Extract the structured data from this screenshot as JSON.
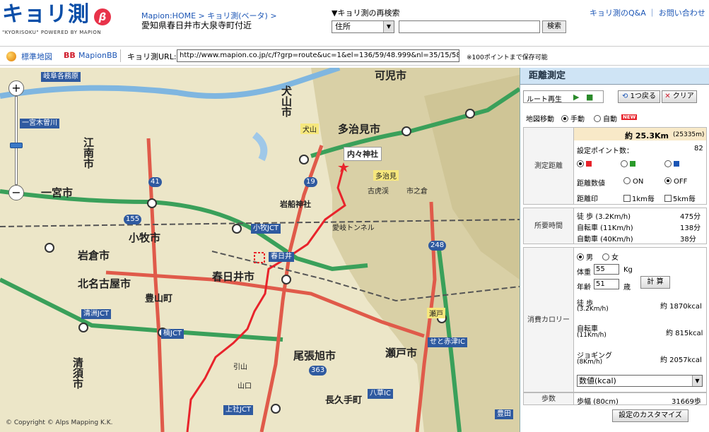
{
  "header": {
    "logo_text": "キョリ測",
    "logo_beta": "β",
    "logo_sub": "\"KYORISOKU\" POWERED BY MAPION",
    "breadcrumb": "Mapion:HOME > キョリ測(ベータ) >",
    "address": "愛知県春日井市大泉寺町付近",
    "research_title": "▼キョリ測の再検索",
    "research_select": "住所",
    "research_input": "",
    "research_button": "検索",
    "links": "キョリ測のQ&A ｜ お問い合わせ"
  },
  "toolbar": {
    "standard_map": "標準地図",
    "bb_icon": "BB",
    "mapion_bb": "MapionBB",
    "url_label": "キョリ測URL:",
    "url_value": "http://www.mapion.co.jp/c/f?grp=route&uc=1&el=136/59/48.999&nl=35/15/58.",
    "url_note": "※100ポイントまで保存可能"
  },
  "map": {
    "labels": {
      "kanimachi": "可児市",
      "inuyama": "犬山市",
      "tajimi": "多治見市",
      "konan": "江南市",
      "ichinomiya": "一宮市",
      "iwakura": "岩倉市",
      "komaki": "小牧市",
      "kitanagoya": "北名古屋市",
      "kasugai": "春日井市",
      "toyoyama": "豊山町",
      "owariasahi": "尾張旭市",
      "seto": "瀬戸市",
      "nagakute": "長久手町",
      "kiyosu": "清須市",
      "utsutsu_shrine": "内々神社",
      "iwafune_shrine": "岩船神社",
      "kasugai_ic": "春日井",
      "inuyama_tag": "犬山",
      "tajimi_tag": "多治見",
      "seto_tag": "瀬戸",
      "komaki_jct": "小牧JCT",
      "kiyosu_jct": "清洲JCT",
      "kachi_jct": "楠JCT",
      "kamishino_jct": "上社JCT",
      "yagusa_ic": "八草IC",
      "seto_akazu_ic": "せと赤津IC",
      "ichinomiya_kisogawa": "一宮木曽川",
      "gifu_hashima": "岐阜各務原",
      "toyota": "豊田",
      "route41": "41",
      "route19": "19",
      "route155": "155",
      "route248": "248",
      "route363": "363",
      "tunnel": "愛岐トンネル",
      "kokeihan": "古虎渓",
      "ichinokura": "市之倉",
      "yamaguchi": "山口",
      "hirakumo": "引山"
    },
    "copyright": "© Copyright © Alps Mapping K.K."
  },
  "panel": {
    "title": "距離測定",
    "route_play": "ルート再生",
    "back_one": "1つ戻る",
    "clear": "クリア",
    "map_move_label": "地図移動",
    "manual": "手動",
    "auto": "自動",
    "new_badge": "NEW",
    "distance_total": "約 25.3Km",
    "distance_m": "(25335m)",
    "measure_label": "測定距離",
    "points_label": "設定ポイント数：",
    "points_value": "82",
    "distance_number_label": "距離数値",
    "on_label": "ON",
    "off_label": "OFF",
    "distance_mark_label": "距離印",
    "km1_label": "1km毎",
    "km5_label": "5km毎",
    "time_label": "所要時間",
    "walk_time_label": "徒 歩 (3.2Km/h)",
    "walk_time_value": "475分",
    "bike_time_label": "自転車 (11Km/h)",
    "bike_time_value": "138分",
    "car_time_label": "自動車 (40Km/h)",
    "car_time_value": "38分",
    "male": "男",
    "female": "女",
    "weight_label": "体重",
    "weight_value": "55",
    "weight_unit": "Kg",
    "age_label": "年齢",
    "age_value": "51",
    "age_unit": "歳",
    "calc_button": "計 算",
    "calorie_label": "消費カロリー",
    "walk_cal_label": "徒 歩",
    "walk_cal_speed": "(3.2Km/h)",
    "walk_cal_value": "約 1870kcal",
    "bike_cal_label": "自転車",
    "bike_cal_speed": "(11Km/h)",
    "bike_cal_value": "約 815kcal",
    "jog_cal_label": "ジョギング",
    "jog_cal_speed": "(8Km/h)",
    "jog_cal_value": "約 2057kcal",
    "calorie_select": "数値(kcal)",
    "steps_label": "歩数",
    "steps_stride": "歩幅 (80cm)",
    "steps_value": "31669歩",
    "customize_button": "設定のカスタマイズ"
  }
}
